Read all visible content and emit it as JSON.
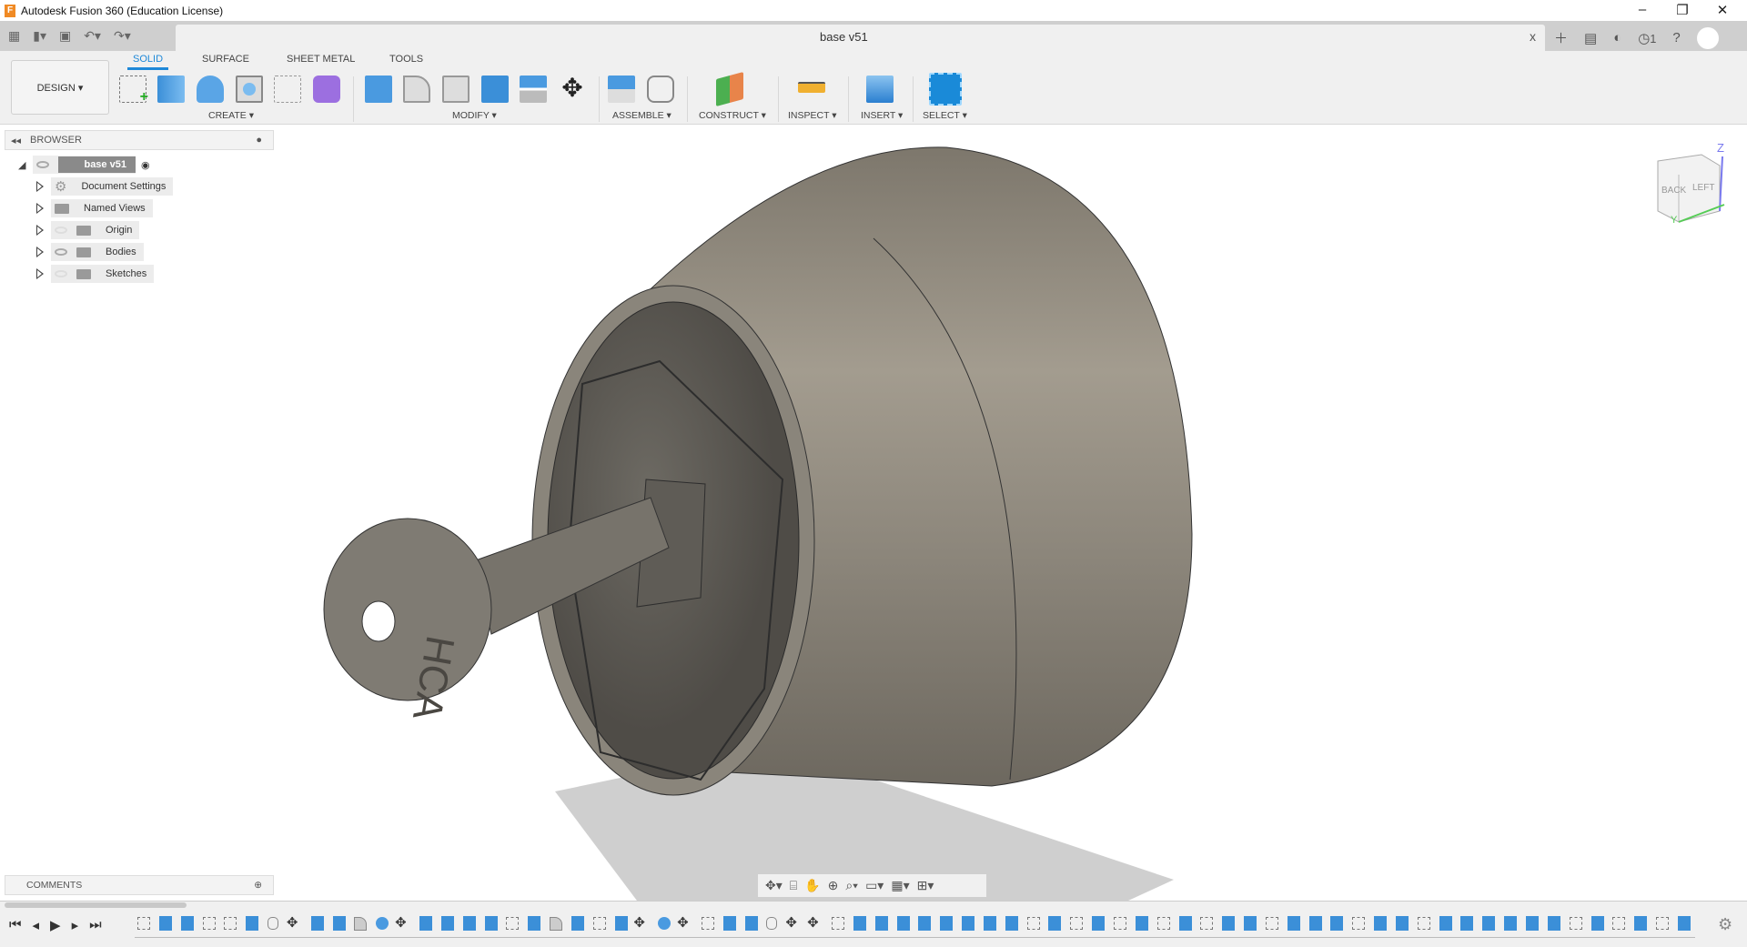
{
  "window": {
    "title": "Autodesk Fusion 360 (Education License)",
    "app_icon": "F",
    "minimize": "–",
    "restore": "❐",
    "close": "✕"
  },
  "document": {
    "tab_name": "base v51",
    "close": "x"
  },
  "header_icons": {
    "notifications": "1"
  },
  "toolbar": {
    "workspace": "DESIGN ▾",
    "tabs": [
      "SOLID",
      "SURFACE",
      "SHEET METAL",
      "TOOLS"
    ],
    "active_tab": "SOLID",
    "groups": [
      "CREATE ▾",
      "MODIFY ▾",
      "ASSEMBLE ▾",
      "CONSTRUCT ▾",
      "INSPECT ▾",
      "INSERT ▾",
      "SELECT ▾"
    ],
    "accent": "#1e88d8"
  },
  "browser": {
    "title": "BROWSER",
    "root": "base v51",
    "items": [
      {
        "label": "Document Settings",
        "icon": "gear-icon",
        "visible": null
      },
      {
        "label": "Named Views",
        "icon": "folder-icon",
        "visible": null
      },
      {
        "label": "Origin",
        "icon": "folder-icon",
        "visible": false
      },
      {
        "label": "Bodies",
        "icon": "folder-icon",
        "visible": true
      },
      {
        "label": "Sketches",
        "icon": "folder-icon",
        "visible": false
      }
    ]
  },
  "comments": {
    "title": "COMMENTS"
  },
  "viewcube": {
    "faces": [
      "BACK",
      "LEFT"
    ],
    "axes": [
      "Z",
      "Y"
    ]
  },
  "model": {
    "key_engraving": "HCA",
    "body_color": "#8f8a80"
  },
  "timeline": {
    "features": "seesshjmcpfomxxccsefcsemomseejmmseeeeeecesesesesesecseecsepseeccee sesesh"
  }
}
